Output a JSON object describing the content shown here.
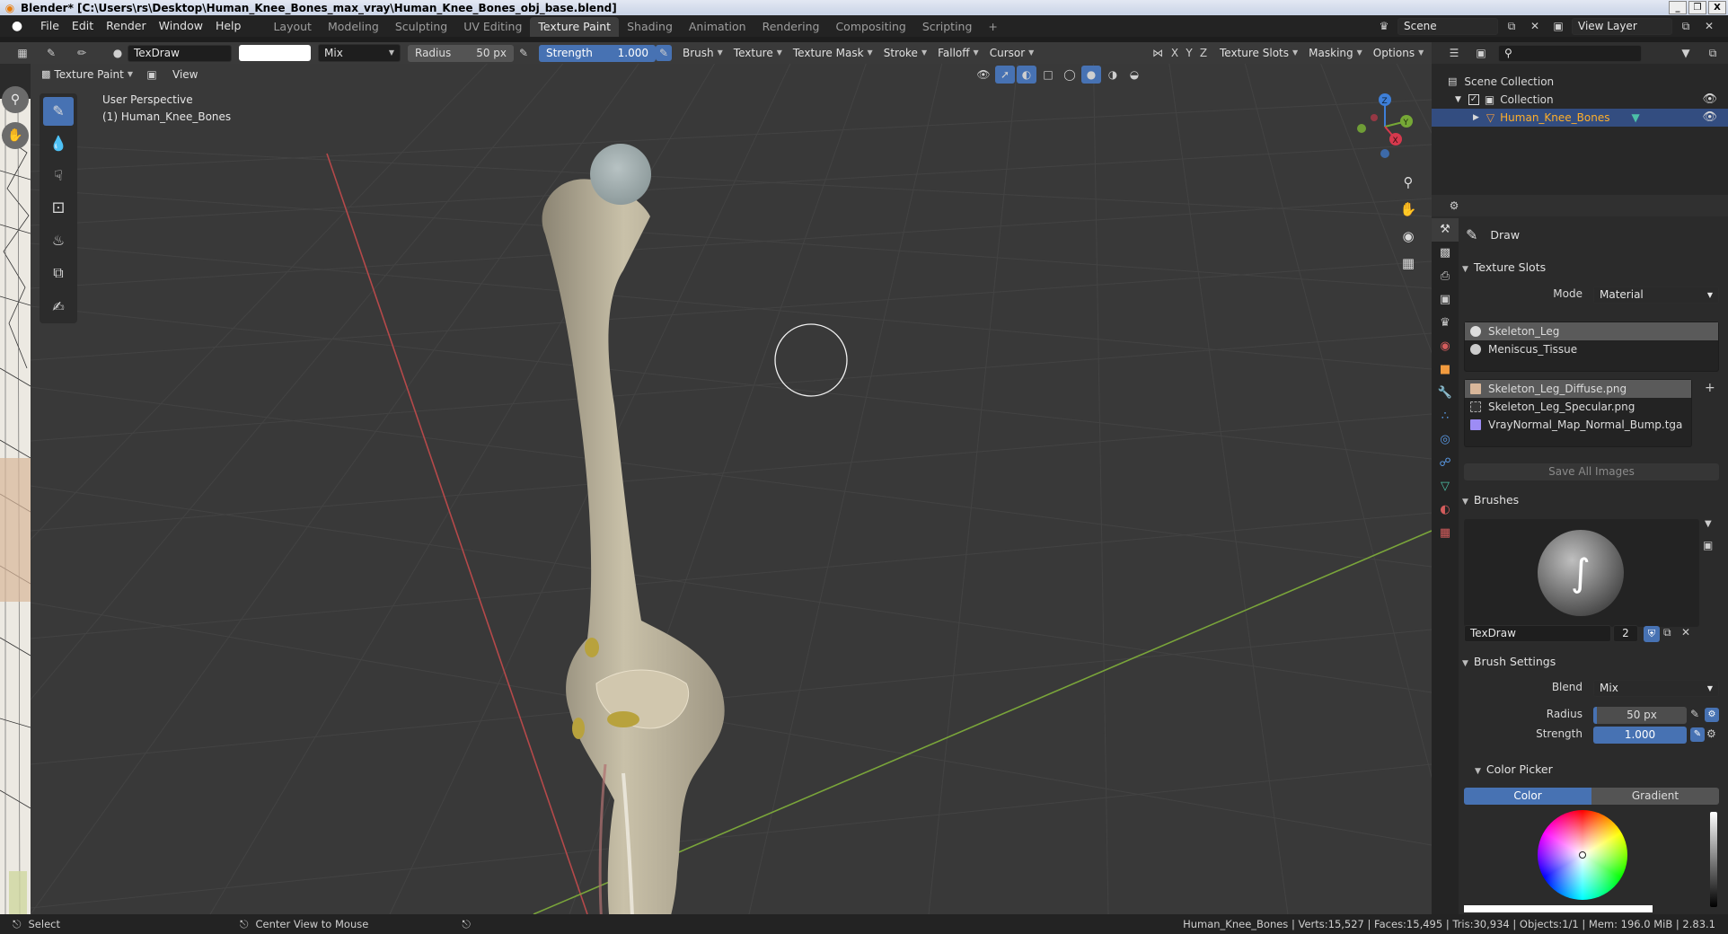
{
  "window": {
    "title": "Blender* [C:\\Users\\rs\\Desktop\\Human_Knee_Bones_max_vray\\Human_Knee_Bones_obj_base.blend]",
    "controls": [
      "_",
      "❒",
      "X"
    ]
  },
  "menu": [
    "File",
    "Edit",
    "Render",
    "Window",
    "Help"
  ],
  "workspaces": [
    {
      "label": "Layout",
      "active": false
    },
    {
      "label": "Modeling",
      "active": false
    },
    {
      "label": "Sculpting",
      "active": false
    },
    {
      "label": "UV Editing",
      "active": false
    },
    {
      "label": "Texture Paint",
      "active": true
    },
    {
      "label": "Shading",
      "active": false
    },
    {
      "label": "Animation",
      "active": false
    },
    {
      "label": "Rendering",
      "active": false
    },
    {
      "label": "Compositing",
      "active": false
    },
    {
      "label": "Scripting",
      "active": false
    }
  ],
  "add_workspace": "+",
  "scene": {
    "value": "Scene",
    "view_layer": "View Layer"
  },
  "tool_header": {
    "brush_name": "TexDraw",
    "blend": "Mix",
    "radius_label": "Radius",
    "radius_value": "50 px",
    "strength_label": "Strength",
    "strength_value": "1.000",
    "menus": [
      "Brush",
      "Texture",
      "Texture Mask",
      "Stroke",
      "Falloff",
      "Cursor"
    ],
    "axes": [
      "X",
      "Y",
      "Z"
    ],
    "right_menus": [
      "Texture Slots",
      "Masking",
      "Options"
    ]
  },
  "view_header": {
    "mode": "Texture Paint",
    "view": "View"
  },
  "viewport": {
    "perspective": "User Perspective",
    "object": "(1) Human_Knee_Bones",
    "gizmo": {
      "z": "Z",
      "y": "Y",
      "x": "X"
    }
  },
  "outliner": {
    "scene_collection": "Scene Collection",
    "collection": "Collection",
    "object": "Human_Knee_Bones"
  },
  "properties": {
    "tool": "Draw",
    "texture_slots": {
      "title": "Texture Slots",
      "mode_label": "Mode",
      "mode_value": "Material",
      "materials": [
        "Skeleton_Leg",
        "Meniscus_Tissue"
      ],
      "images": [
        "Skeleton_Leg_Diffuse.png",
        "Skeleton_Leg_Specular.png",
        "VrayNormal_Map_Normal_Bump.tga"
      ],
      "save_all": "Save All Images"
    },
    "brushes": {
      "title": "Brushes",
      "name": "TexDraw",
      "users": "2"
    },
    "brush_settings": {
      "title": "Brush Settings",
      "blend_label": "Blend",
      "blend_value": "Mix",
      "radius_label": "Radius",
      "radius_value": "50 px",
      "strength_label": "Strength",
      "strength_value": "1.000"
    },
    "color_picker": {
      "title": "Color Picker",
      "tabs": [
        "Color",
        "Gradient"
      ]
    }
  },
  "status": {
    "select": "Select",
    "center": "Center View to Mouse",
    "stats": "Human_Knee_Bones | Verts:15,527 | Faces:15,495 | Tris:30,934 | Objects:1/1 | Mem: 196.0 MiB | 2.83.1"
  },
  "colors": {
    "accent": "#4772b3",
    "viewport_bg": "#393939",
    "header_bg": "#3a3a3a",
    "panel_bg": "#2b2b2b",
    "grid_x": "#b5494a",
    "grid_y": "#7aa53a"
  }
}
